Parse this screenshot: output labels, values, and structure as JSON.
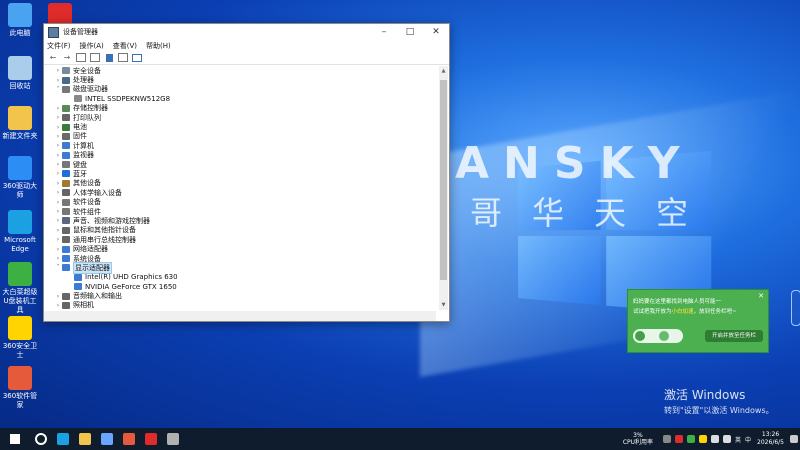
{
  "desktop": {
    "icons": [
      {
        "label": "此电脑",
        "color": "#4aa3f0"
      },
      {
        "label": "回收站",
        "color": "#a9cdea"
      },
      {
        "label": "新建文件夹",
        "color": "#f3c44c"
      },
      {
        "label": "360驱动大师",
        "color": "#2c8ef5"
      },
      {
        "label": "Microsoft Edge",
        "color": "#1ba1e2"
      },
      {
        "label": "大白菜超级U盘装机工具",
        "color": "#3cb043"
      },
      {
        "label": "360安全卫士",
        "color": "#ffd400"
      },
      {
        "label": "360软件管家",
        "color": "#e65a3c"
      },
      {
        "label": "WPS",
        "color": "#e02b2b"
      }
    ],
    "brand_text": "ANSKY",
    "brand_sub": "哥华天空",
    "activation": {
      "title": "激活 Windows",
      "subtitle": "转到\"设置\"以激活 Windows。"
    }
  },
  "window": {
    "title": "设备管理器",
    "menu": [
      "文件(F)",
      "操作(A)",
      "查看(V)",
      "帮助(H)"
    ],
    "tree": [
      {
        "label": "安全设备",
        "indent": 1,
        "arrow": ">",
        "color": "#7a8a9a"
      },
      {
        "label": "处理器",
        "indent": 1,
        "arrow": ">",
        "color": "#4b6a8a"
      },
      {
        "label": "磁盘驱动器",
        "indent": 1,
        "arrow": "v",
        "color": "#777"
      },
      {
        "label": "INTEL SSDPEKNW512G8",
        "indent": 2,
        "arrow": "",
        "color": "#888"
      },
      {
        "label": "存储控制器",
        "indent": 1,
        "arrow": ">",
        "color": "#5a8a5a"
      },
      {
        "label": "打印队列",
        "indent": 1,
        "arrow": ">",
        "color": "#666"
      },
      {
        "label": "电池",
        "indent": 1,
        "arrow": ">",
        "color": "#3a7d3a"
      },
      {
        "label": "固件",
        "indent": 1,
        "arrow": ">",
        "color": "#6a6a6a"
      },
      {
        "label": "计算机",
        "indent": 1,
        "arrow": ">",
        "color": "#3d7ad6"
      },
      {
        "label": "监视器",
        "indent": 1,
        "arrow": ">",
        "color": "#3d7ad6"
      },
      {
        "label": "键盘",
        "indent": 1,
        "arrow": ">",
        "color": "#777"
      },
      {
        "label": "蓝牙",
        "indent": 1,
        "arrow": ">",
        "color": "#1e6fd9"
      },
      {
        "label": "其他设备",
        "indent": 1,
        "arrow": ">",
        "color": "#a07a30"
      },
      {
        "label": "人体学输入设备",
        "indent": 1,
        "arrow": ">",
        "color": "#666"
      },
      {
        "label": "软件设备",
        "indent": 1,
        "arrow": ">",
        "color": "#777"
      },
      {
        "label": "软件组件",
        "indent": 1,
        "arrow": ">",
        "color": "#777"
      },
      {
        "label": "声音、视频和游戏控制器",
        "indent": 1,
        "arrow": ">",
        "color": "#5a6a7a"
      },
      {
        "label": "鼠标和其他指针设备",
        "indent": 1,
        "arrow": ">",
        "color": "#666"
      },
      {
        "label": "通用串行总线控制器",
        "indent": 1,
        "arrow": ">",
        "color": "#666"
      },
      {
        "label": "网络适配器",
        "indent": 1,
        "arrow": ">",
        "color": "#3d7ad6"
      },
      {
        "label": "系统设备",
        "indent": 1,
        "arrow": ">",
        "color": "#3d7ad6"
      },
      {
        "label": "显示适配器",
        "indent": 1,
        "arrow": "v",
        "color": "#3d7ad6",
        "selected": true
      },
      {
        "label": "Intel(R) UHD Graphics 630",
        "indent": 2,
        "arrow": "",
        "color": "#3d7ad6"
      },
      {
        "label": "NVIDIA GeForce GTX 1650",
        "indent": 2,
        "arrow": "",
        "color": "#3d7ad6"
      },
      {
        "label": "音频输入和输出",
        "indent": 1,
        "arrow": ">",
        "color": "#666"
      },
      {
        "label": "照相机",
        "indent": 1,
        "arrow": ">",
        "color": "#666"
      }
    ]
  },
  "popup": {
    "line1": "妈妈要在这里都找到电脑人员可能一",
    "line2_pre": "试试把我开放为",
    "line2_highlight": "小白加速",
    "line2_post": "，放到任务栏吧~",
    "button": "开启并放至任务栏"
  },
  "taskbar": {
    "cpu_percent": "3%",
    "cpu_label": "CPU利用率",
    "time": "13:26",
    "date": "2026/6/5",
    "ime": "英",
    "ime2": "中",
    "icons": [
      {
        "name": "windows-start-icon",
        "color": "#ffffff"
      },
      {
        "name": "search-icon",
        "color": "#ffffff"
      },
      {
        "name": "edge-icon",
        "color": "#1ba1e2"
      },
      {
        "name": "explorer-icon",
        "color": "#f3c44c"
      },
      {
        "name": "store-icon",
        "color": "#6aa6ff"
      },
      {
        "name": "app-icon",
        "color": "#e65a3c"
      },
      {
        "name": "wps-icon",
        "color": "#e02b2b"
      },
      {
        "name": "device-manager-icon",
        "color": "#b0b0b0"
      }
    ]
  }
}
